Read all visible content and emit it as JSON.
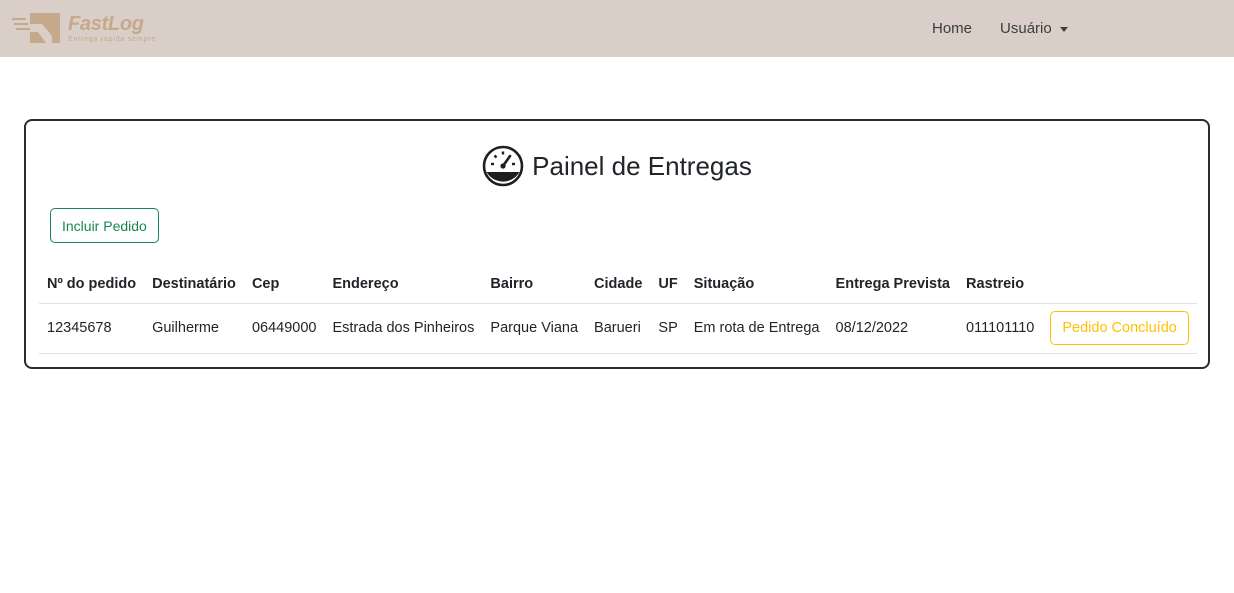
{
  "brand": {
    "name": "FastLog",
    "tagline": "Entrega rápida sempre"
  },
  "nav": {
    "home": "Home",
    "user": "Usuário"
  },
  "panel": {
    "icon": "speedometer-icon",
    "title": "Painel de Entregas",
    "include_button": "Incluir Pedido"
  },
  "table": {
    "headers": [
      "Nº do pedido",
      "Destinatário",
      "Cep",
      "Endereço",
      "Bairro",
      "Cidade",
      "UF",
      "Situação",
      "Entrega Prevista",
      "Rastreio",
      ""
    ],
    "rows": [
      {
        "pedido": "12345678",
        "destinatario": "Guilherme",
        "cep": "06449000",
        "endereco": "Estrada dos Pinheiros",
        "bairro": "Parque Viana",
        "cidade": "Barueri",
        "uf": "SP",
        "situacao": "Em rota de Entrega",
        "entrega_prevista": "08/12/2022",
        "rastreio": "011101110",
        "action": "Pedido Concluído"
      }
    ]
  },
  "colors": {
    "navbar": "#d9cfc8",
    "brand": "#c4a98a",
    "success": "#198754",
    "warning": "#ffc107",
    "panel_border": "#2b2b2b"
  }
}
